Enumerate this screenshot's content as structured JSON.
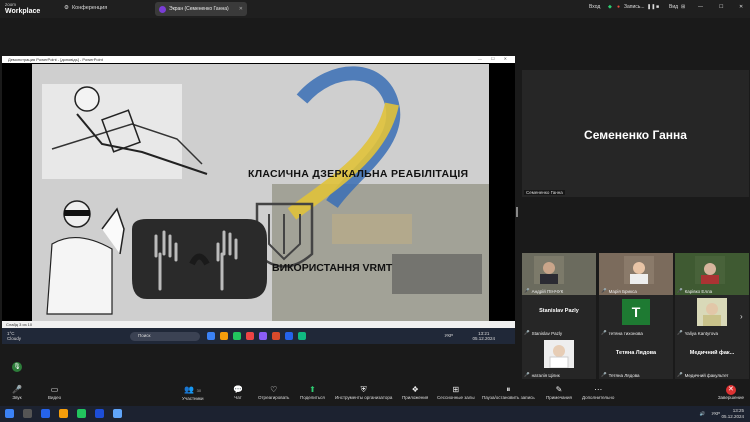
{
  "zoom": {
    "logo_small": "zoom",
    "logo_big": "Workplace",
    "conference_label": "Конференция",
    "screen_tab_label": "Экран (Семененко Ганна)",
    "top_right": {
      "login": "Вход",
      "recording": "Запись...",
      "view": "Вид"
    }
  },
  "powerpoint": {
    "window_title": "Демонстрация PowerPoint - [доповідь] - PowerPoint",
    "slide_heading_1": "КЛАСИЧНА ДЗЕРКАЛЬНА РЕАБІЛІТАЦІЯ",
    "slide_heading_2": "ВИКОРИСТАННЯ VRMT",
    "status_left": "Слайд 3 из 10"
  },
  "shared_taskbar": {
    "weather_temp": "1°C",
    "weather_desc": "Cloudy",
    "search_placeholder": "Поиск",
    "lang": "УКР",
    "time": "13:21",
    "date": "05.12.2024"
  },
  "speaker": {
    "name_large": "Семененко Ганна",
    "name_small": "Семененко Ганна"
  },
  "participants": [
    {
      "name": "Андрій ПІНЧУК",
      "type": "video"
    },
    {
      "name": "Марія Брикса",
      "type": "video"
    },
    {
      "name": "Карівко Елла",
      "type": "video"
    },
    {
      "name": "Stanislav Pazly",
      "type": "name",
      "title": "Stanislav Pazly"
    },
    {
      "name": "тетяна тихонова",
      "type": "avatar",
      "initial": "T"
    },
    {
      "name": "Yaliya Kantyrova",
      "type": "video"
    },
    {
      "name": "наталія Цілик",
      "type": "video"
    },
    {
      "name": "Тетяна Лядова",
      "type": "name",
      "title": "Тетяна Лядова"
    },
    {
      "name": "Медичний факультет",
      "type": "name",
      "title": "Медичний фак..."
    }
  ],
  "toolbar": {
    "audio": "Звук",
    "video": "Видео",
    "participants": "Участники",
    "participants_count": "30",
    "chat": "Чат",
    "react": "Отреагировать",
    "share": "Поделиться",
    "host_tools": "Инструменты организатора",
    "apps": "Приложения",
    "breakout": "Сессионные залы",
    "pause_share": "Пауза/остановить запись",
    "notes": "Примечания",
    "more": "Дополнительно",
    "end": "Завершение"
  },
  "os_taskbar": {
    "lang": "УКР",
    "time": "13:25",
    "date": "05.12.2024"
  }
}
